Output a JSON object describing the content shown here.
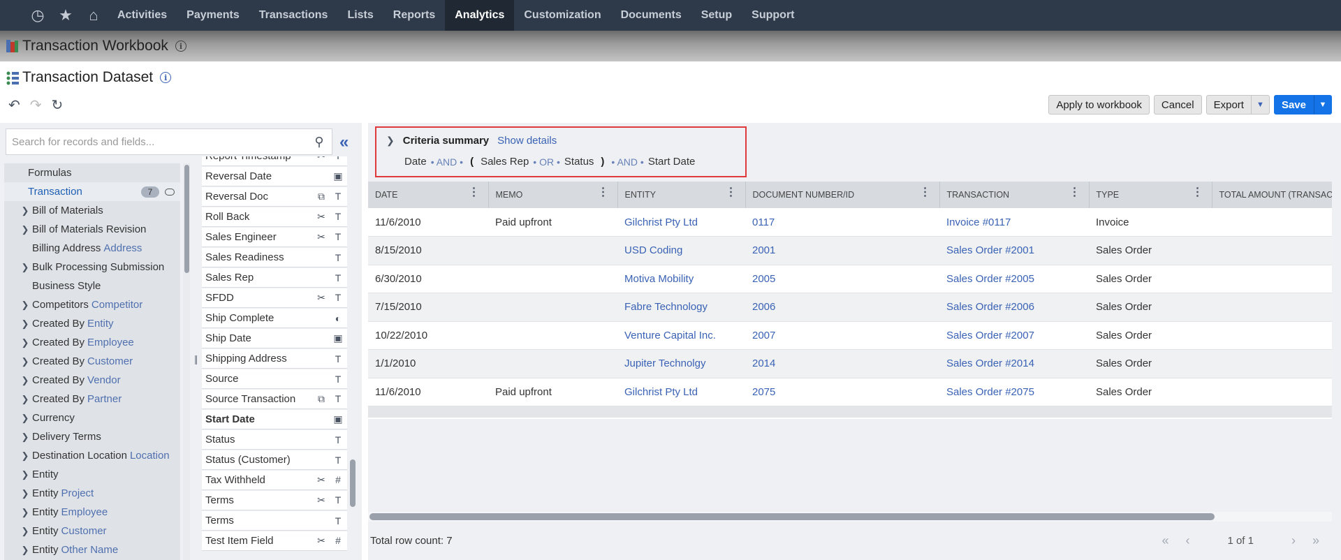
{
  "nav": {
    "items": [
      "Activities",
      "Payments",
      "Transactions",
      "Lists",
      "Reports",
      "Analytics",
      "Customization",
      "Documents",
      "Setup",
      "Support"
    ],
    "active": "Analytics"
  },
  "workbook": {
    "title": "Transaction Workbook"
  },
  "dataset": {
    "title": "Transaction Dataset"
  },
  "actions": {
    "apply": "Apply to workbook",
    "cancel": "Cancel",
    "export": "Export",
    "save": "Save"
  },
  "search": {
    "placeholder": "Search for records and fields..."
  },
  "tree": {
    "formulas": "Formulas",
    "selected": {
      "label": "Transaction",
      "badge": "7"
    },
    "items": [
      {
        "label": "Bill of Materials",
        "suffix": "",
        "chev": true
      },
      {
        "label": "Bill of Materials Revision",
        "suffix": "",
        "chev": true
      },
      {
        "label": "Billing Address",
        "suffix": "Address",
        "chev": false
      },
      {
        "label": "Bulk Processing Submission",
        "suffix": "",
        "chev": true
      },
      {
        "label": "Business Style",
        "suffix": "",
        "chev": false
      },
      {
        "label": "Competitors",
        "suffix": "Competitor",
        "chev": true
      },
      {
        "label": "Created By",
        "suffix": "Entity",
        "chev": true
      },
      {
        "label": "Created By",
        "suffix": "Employee",
        "chev": true
      },
      {
        "label": "Created By",
        "suffix": "Customer",
        "chev": true
      },
      {
        "label": "Created By",
        "suffix": "Vendor",
        "chev": true
      },
      {
        "label": "Created By",
        "suffix": "Partner",
        "chev": true
      },
      {
        "label": "Currency",
        "suffix": "",
        "chev": true
      },
      {
        "label": "Delivery Terms",
        "suffix": "",
        "chev": true
      },
      {
        "label": "Destination Location",
        "suffix": "Location",
        "chev": true
      },
      {
        "label": "Entity",
        "suffix": "",
        "chev": true
      },
      {
        "label": "Entity",
        "suffix": "Project",
        "chev": true
      },
      {
        "label": "Entity",
        "suffix": "Employee",
        "chev": true
      },
      {
        "label": "Entity",
        "suffix": "Customer",
        "chev": true
      },
      {
        "label": "Entity",
        "suffix": "Other Name",
        "chev": true
      }
    ]
  },
  "fields": [
    {
      "label": "Report Timestamp",
      "icons": [
        "wrench-icon",
        "text-icon"
      ],
      "bold": false
    },
    {
      "label": "Reversal Date",
      "icons": [
        "calendar-icon"
      ],
      "bold": false
    },
    {
      "label": "Reversal Doc",
      "icons": [
        "relation-icon",
        "text-icon"
      ],
      "bold": false
    },
    {
      "label": "Roll Back",
      "icons": [
        "wrench-icon",
        "text-icon"
      ],
      "bold": false
    },
    {
      "label": "Sales Engineer",
      "icons": [
        "wrench-icon",
        "text-icon"
      ],
      "bold": false
    },
    {
      "label": "Sales Readiness",
      "icons": [
        "text-icon"
      ],
      "bold": false
    },
    {
      "label": "Sales Rep",
      "icons": [
        "text-icon"
      ],
      "bold": false
    },
    {
      "label": "SFDD",
      "icons": [
        "wrench-icon",
        "text-icon"
      ],
      "bold": false
    },
    {
      "label": "Ship Complete",
      "icons": [
        "toggle-icon"
      ],
      "bold": false
    },
    {
      "label": "Ship Date",
      "icons": [
        "calendar-icon"
      ],
      "bold": false
    },
    {
      "label": "Shipping Address",
      "icons": [
        "text-icon"
      ],
      "bold": false
    },
    {
      "label": "Source",
      "icons": [
        "text-icon"
      ],
      "bold": false
    },
    {
      "label": "Source Transaction",
      "icons": [
        "relation-icon",
        "text-icon"
      ],
      "bold": false
    },
    {
      "label": "Start Date",
      "icons": [
        "calendar-icon"
      ],
      "bold": true
    },
    {
      "label": "Status",
      "icons": [
        "text-icon"
      ],
      "bold": false
    },
    {
      "label": "Status (Customer)",
      "icons": [
        "text-icon"
      ],
      "bold": false
    },
    {
      "label": "Tax Withheld",
      "icons": [
        "wrench-icon",
        "hash-icon"
      ],
      "bold": false
    },
    {
      "label": "Terms",
      "icons": [
        "wrench-icon",
        "text-icon"
      ],
      "bold": false
    },
    {
      "label": "Terms",
      "icons": [
        "text-icon"
      ],
      "bold": false
    },
    {
      "label": "Test Item Field",
      "icons": [
        "wrench-icon",
        "hash-icon"
      ],
      "bold": false
    }
  ],
  "criteria": {
    "title": "Criteria summary",
    "show_details": "Show details",
    "terms": {
      "date": "Date",
      "and1": "AND",
      "open": "(",
      "sales_rep": "Sales Rep",
      "or": "OR",
      "status": "Status",
      "close": ")",
      "and2": "AND",
      "start_date": "Start Date"
    }
  },
  "grid": {
    "columns": [
      "DATE",
      "MEMO",
      "ENTITY",
      "DOCUMENT NUMBER/ID",
      "TRANSACTION",
      "TYPE",
      "TOTAL AMOUNT (TRANSACT"
    ],
    "rows": [
      [
        "11/6/2010",
        "Paid upfront",
        "Gilchrist Pty Ltd",
        "0117",
        "Invoice #0117",
        "Invoice",
        ""
      ],
      [
        "8/15/2010",
        "",
        "USD Coding",
        "2001",
        "Sales Order #2001",
        "Sales Order",
        ""
      ],
      [
        "6/30/2010",
        "",
        "Motiva Mobility",
        "2005",
        "Sales Order #2005",
        "Sales Order",
        ""
      ],
      [
        "7/15/2010",
        "",
        "Fabre Technology",
        "2006",
        "Sales Order #2006",
        "Sales Order",
        ""
      ],
      [
        "10/22/2010",
        "",
        "Venture Capital Inc.",
        "2007",
        "Sales Order #2007",
        "Sales Order",
        ""
      ],
      [
        "1/1/2010",
        "",
        "Jupiter Technolgy",
        "2014",
        "Sales Order #2014",
        "Sales Order",
        ""
      ],
      [
        "11/6/2010",
        "Paid upfront",
        "Gilchrist Pty Ltd",
        "2075",
        "Sales Order #2075",
        "Sales Order",
        ""
      ]
    ],
    "row_count": "Total row count: 7",
    "pages": "1 of 1"
  }
}
